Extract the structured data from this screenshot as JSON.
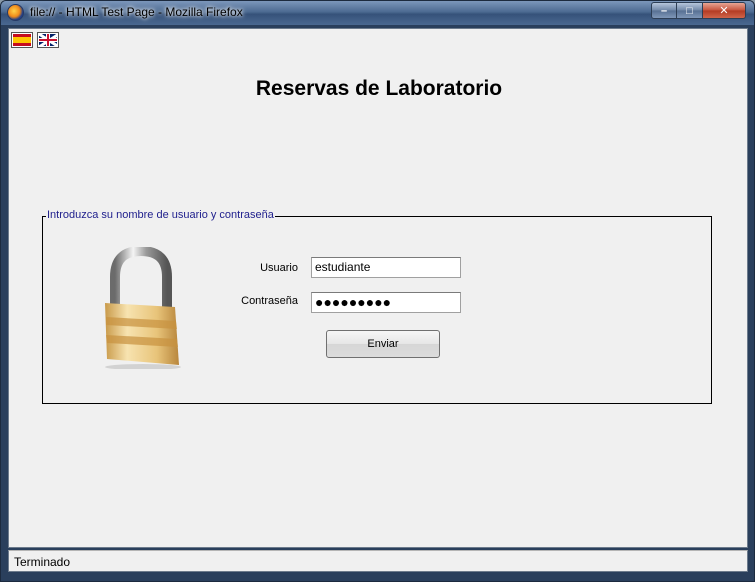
{
  "window": {
    "title": "file:// - HTML Test Page - Mozilla Firefox",
    "minimize": "–",
    "maximize": "□",
    "close": "✕"
  },
  "languages": [
    {
      "name": "Español",
      "icon": "spanish-flag-icon"
    },
    {
      "name": "English",
      "icon": "uk-flag-icon"
    }
  ],
  "page": {
    "title": "Reservas de Laboratorio"
  },
  "login": {
    "legend": "Introduzca su nombre de usuario y contraseña",
    "username_label": "Usuario",
    "username_value": "estudiante",
    "password_label": "Contraseña",
    "password_value": "●●●●●●●●●",
    "submit_label": "Enviar",
    "icon": "padlock-icon"
  },
  "status": {
    "text": "Terminado"
  },
  "colors": {
    "legend_text": "#1e1e8c",
    "page_background": "#f0f0f0"
  }
}
